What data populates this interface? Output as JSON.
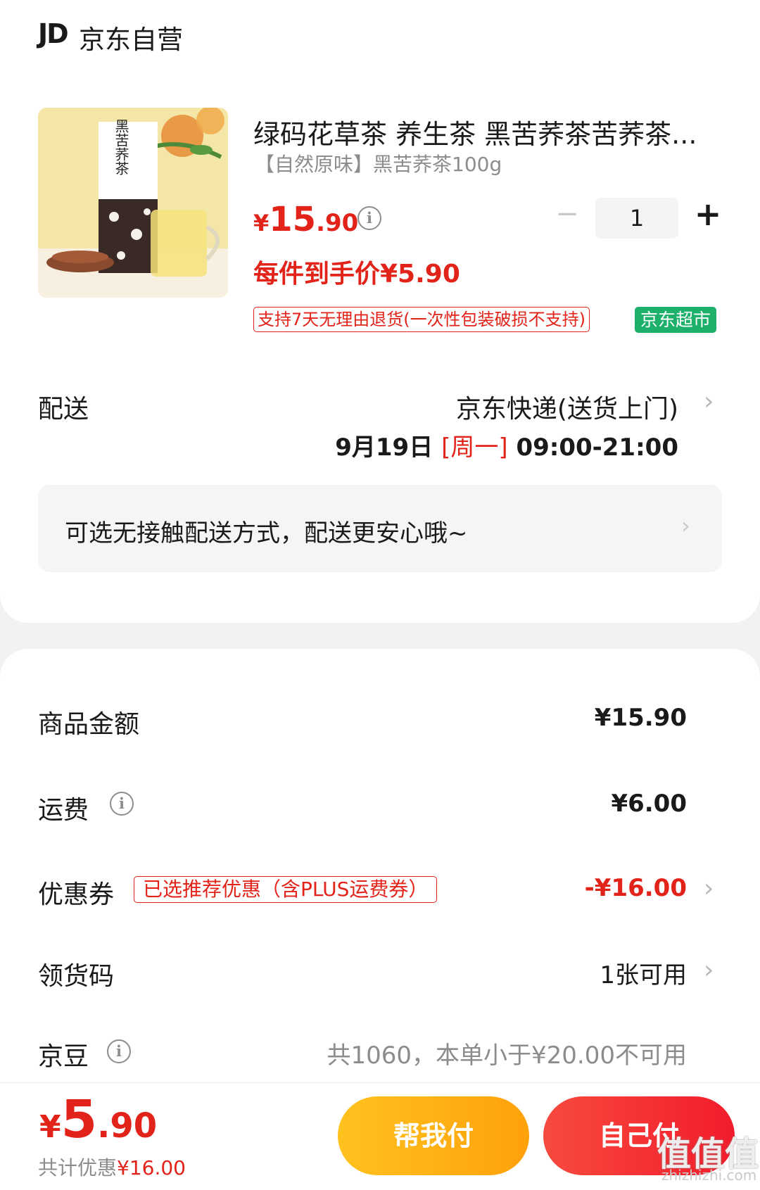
{
  "header": {
    "logo": "JD",
    "shop_name": "京东自营"
  },
  "product": {
    "title": "绿码花草茶 养生茶 黑苦荞茶苦荞茶...",
    "spec": "【自然原味】黑苦荞茶100g",
    "price": {
      "currency": "¥",
      "integer": "15",
      "decimal": ".90"
    },
    "info_icon": "info-icon",
    "quantity": "1",
    "minus_label": "−",
    "plus_label": "+",
    "hand_price": "每件到手价¥5.90",
    "return_tag": "支持7天无理由退货(一次性包装破损不支持)",
    "market_tag": "京东超市",
    "image_text": "黑苦荞茶"
  },
  "delivery": {
    "label": "配送",
    "method": "京东快递(送货上门)",
    "date": "9月19日",
    "weekday": "[周一]",
    "time": "09:00-21:00",
    "notice": "可选无接触配送方式，配送更安心哦~",
    "chevron": "›"
  },
  "summary": {
    "goods_amount": {
      "label": "商品金额",
      "value": "¥15.90"
    },
    "shipping": {
      "label": "运费",
      "value": "¥6.00"
    },
    "coupon": {
      "label": "优惠券",
      "tag": "已选推荐优惠（含PLUS运费券）",
      "value": "-¥16.00"
    },
    "pickup_code": {
      "label": "领货码",
      "value": "1张可用"
    },
    "jd_beans": {
      "label": "京豆",
      "value": "共1060，本单小于¥20.00不可用"
    }
  },
  "bottom": {
    "total": {
      "currency": "¥",
      "integer": "5",
      "decimal": ".90"
    },
    "saved_prefix": "共计优惠",
    "saved_value": "¥16.00",
    "help_pay": "帮我付",
    "self_pay": "自己付",
    "watermark": "值值值",
    "watermark_url": "zhizhizhi.com"
  },
  "colors": {
    "accent": "#e2231a",
    "market_green": "#1cb06b",
    "help_btn": "#ffb316",
    "self_btn": "#f4303a"
  }
}
